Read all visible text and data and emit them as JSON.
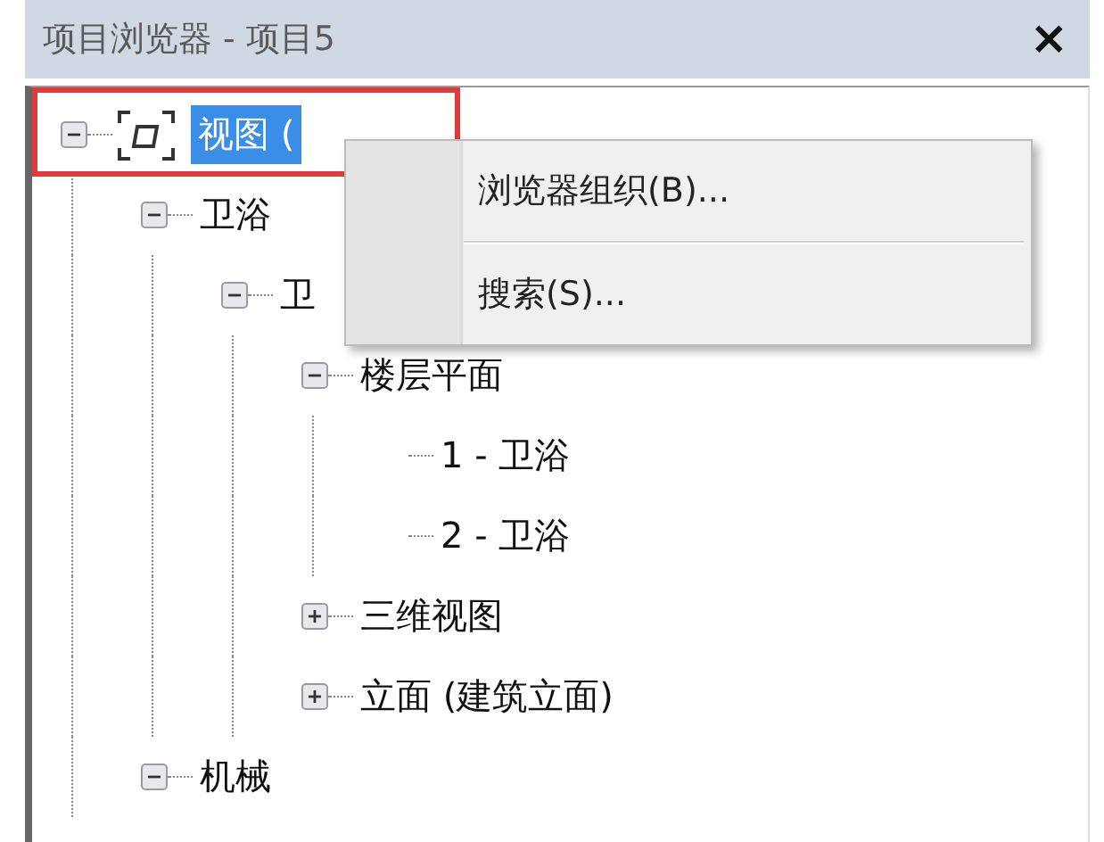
{
  "window": {
    "title": "项目浏览器 - 项目5",
    "close": "×"
  },
  "tree": [
    {
      "label": "视图 (",
      "selected": true,
      "expanded": true,
      "kind": "root",
      "children": [
        {
          "label": "卫浴",
          "selected": false,
          "expanded": true,
          "children": [
            {
              "label": "卫",
              "selected": false,
              "expanded": true,
              "children": [
                {
                  "label": "楼层平面",
                  "selected": false,
                  "expanded": true,
                  "children": [
                    {
                      "label": "1 - 卫浴",
                      "selected": false
                    },
                    {
                      "label": "2 - 卫浴",
                      "selected": false
                    }
                  ]
                },
                {
                  "label": "三维视图",
                  "selected": false,
                  "expanded": false
                },
                {
                  "label": "立面 (建筑立面)",
                  "selected": false,
                  "expanded": false
                }
              ]
            }
          ]
        },
        {
          "label": "机械",
          "selected": false,
          "expanded": true
        }
      ]
    }
  ],
  "context_menu": {
    "items": [
      "浏览器组织(B)...",
      "搜索(S)..."
    ]
  }
}
